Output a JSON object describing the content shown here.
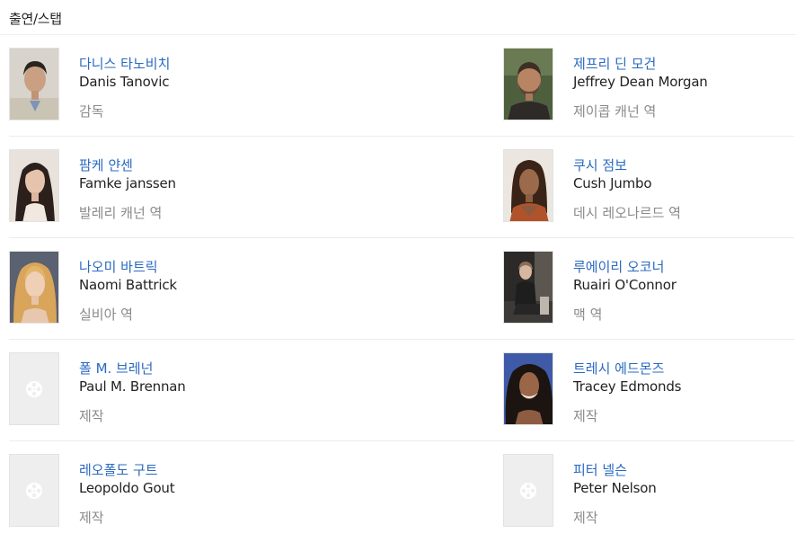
{
  "section": {
    "title": "출연/스탭"
  },
  "cast": [
    {
      "name_ko": "다니스 타노비치",
      "name_en": "Danis Tanovic",
      "role": "감독",
      "photo": "portrait-man-dark-hair-light-background",
      "has_photo": true
    },
    {
      "name_ko": "제프리 딘 모건",
      "name_en": "Jeffrey Dean Morgan",
      "role": "제이콥 캐넌 역",
      "photo": "portrait-man-stubble-dark-shirt",
      "has_photo": true
    },
    {
      "name_ko": "팜케 얀센",
      "name_en": "Famke janssen",
      "role": "발레리 캐넌 역",
      "photo": "portrait-woman-dark-hair",
      "has_photo": true
    },
    {
      "name_ko": "쿠시 점보",
      "name_en": "Cush Jumbo",
      "role": "데시 레오나르드 역",
      "photo": "portrait-woman-curly-hair",
      "has_photo": true
    },
    {
      "name_ko": "나오미 바트릭",
      "name_en": "Naomi Battrick",
      "role": "실비아 역",
      "photo": "portrait-woman-blonde-hair",
      "has_photo": true
    },
    {
      "name_ko": "루에이리 오코너",
      "name_en": "Ruairi O'Connor",
      "role": "맥 역",
      "photo": "portrait-man-seated-dark-room",
      "has_photo": true
    },
    {
      "name_ko": "폴 M. 브레넌",
      "name_en": "Paul M. Brennan",
      "role": "제작",
      "photo": "film-reel-placeholder-icon",
      "has_photo": false
    },
    {
      "name_ko": "트레시 에드몬즈",
      "name_en": "Tracey Edmonds",
      "role": "제작",
      "photo": "portrait-woman-long-dark-hair",
      "has_photo": true
    },
    {
      "name_ko": "레오폴도 구트",
      "name_en": "Leopoldo Gout",
      "role": "제작",
      "photo": "film-reel-placeholder-icon",
      "has_photo": false
    },
    {
      "name_ko": "피터 넬슨",
      "name_en": "Peter Nelson",
      "role": "제작",
      "photo": "film-reel-placeholder-icon",
      "has_photo": false
    }
  ],
  "colors": {
    "link": "#2a69c1",
    "role_text": "#8a8a8a",
    "divider": "#ececec",
    "placeholder_bg": "#eeeeee"
  }
}
